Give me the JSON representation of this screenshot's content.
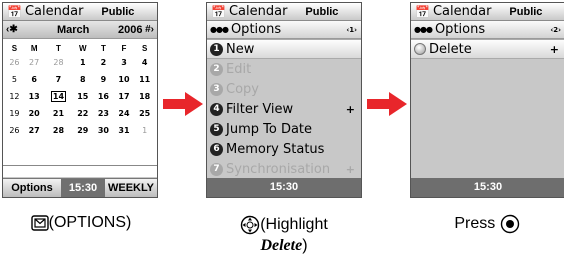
{
  "colors": {
    "arrow": "#e8262b",
    "highlight_bg": "#e6e6e6",
    "softkey_bg": "#6e6e6e"
  },
  "screen1": {
    "title_icon": "calendar-icon",
    "title": "Calendar",
    "visibility": "Public",
    "month": "March",
    "year": "2006",
    "weekdays": [
      "S",
      "M",
      "T",
      "W",
      "T",
      "F",
      "S"
    ],
    "weeks": [
      [
        "26",
        "27",
        "28",
        "1",
        "2",
        "3",
        "4"
      ],
      [
        "5",
        "6",
        "7",
        "8",
        "9",
        "10",
        "11"
      ],
      [
        "12",
        "13",
        "14",
        "15",
        "16",
        "17",
        "18"
      ],
      [
        "19",
        "20",
        "21",
        "22",
        "23",
        "24",
        "25"
      ],
      [
        "26",
        "27",
        "28",
        "29",
        "30",
        "31",
        "1"
      ]
    ],
    "today": "14",
    "softkey_left": "Options",
    "clock": "15:30",
    "softkey_right": "WEEKLY"
  },
  "screen2": {
    "title": "Calendar",
    "visibility": "Public",
    "subheader": "Options",
    "page_indicator": "‹1›",
    "items": [
      {
        "num": "1",
        "label": "New",
        "state": "selected"
      },
      {
        "num": "2",
        "label": "Edit",
        "state": "disabled"
      },
      {
        "num": "3",
        "label": "Copy",
        "state": "disabled"
      },
      {
        "num": "4",
        "label": "Filter View",
        "state": "normal",
        "more": "+"
      },
      {
        "num": "5",
        "label": "Jump To Date",
        "state": "normal"
      },
      {
        "num": "6",
        "label": "Memory Status",
        "state": "normal"
      },
      {
        "num": "7",
        "label": "Synchronisation",
        "state": "disabled",
        "more": "+"
      }
    ],
    "clock": "15:30"
  },
  "screen3": {
    "title": "Calendar",
    "visibility": "Public",
    "subheader": "Options",
    "page_indicator": "‹2›",
    "items": [
      {
        "label": "Delete",
        "state": "selected",
        "more": "+"
      }
    ],
    "clock": "15:30"
  },
  "captions": {
    "step1": "(OPTIONS)",
    "step2_pre": "(Highlight",
    "step2_em": "Delete",
    "step2_post": ")",
    "step3": "Press"
  }
}
